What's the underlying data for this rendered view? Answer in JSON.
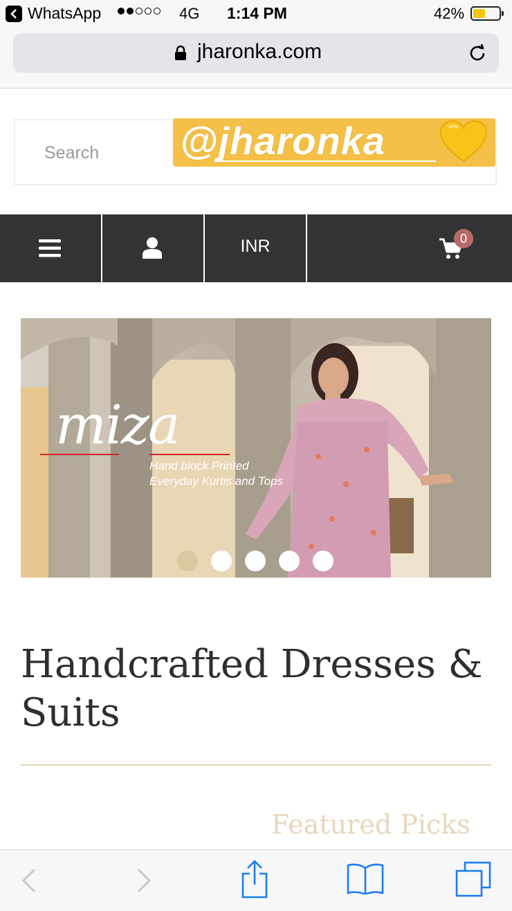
{
  "status_bar": {
    "app": "WhatsApp",
    "network": "4G",
    "time": "1:14 PM",
    "battery": "42%",
    "signal_bars": 2,
    "battery_level": 0.42
  },
  "browser": {
    "url": "jharonka.com"
  },
  "header": {
    "search_placeholder": "Search",
    "sticker_text": "@jharonka"
  },
  "nav": {
    "currency": "INR",
    "cart_count": "0"
  },
  "banner": {
    "brand": "miza",
    "tagline_line1": "Hand block Printed",
    "tagline_line2": "Everyday Kurtis and Tops",
    "slides": 5,
    "active_slide": 1
  },
  "main": {
    "heading": "Handcrafted Dresses & Suits",
    "featured": "Featured Picks"
  },
  "colors": {
    "nav_bg": "#333336",
    "badge": "#b76a6a",
    "sticker": "#f5c048",
    "accent_gold": "#e3d6b8"
  }
}
